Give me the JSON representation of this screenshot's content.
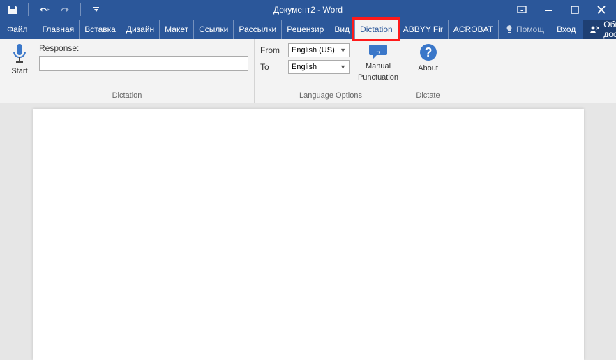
{
  "title": "Документ2 - Word",
  "tabs": {
    "file": "Файл",
    "list": [
      "Главная",
      "Вставка",
      "Дизайн",
      "Макет",
      "Ссылки",
      "Рассылки",
      "Рецензир",
      "Вид",
      "Dictation",
      "ABBYY Fir",
      "ACROBAT"
    ],
    "active_index": 8,
    "help": "Помощ",
    "login": "Вход",
    "share": "Общий доступ"
  },
  "ribbon": {
    "group_dictation": {
      "label": "Dictation",
      "start": "Start",
      "response": "Response:",
      "response_value": ""
    },
    "group_lang": {
      "label": "Language Options",
      "from_label": "From",
      "to_label": "To",
      "from_value": "English (US)",
      "to_value": "English",
      "manual_line1": "Manual",
      "manual_line2": "Punctuation"
    },
    "group_dictate": {
      "label": "Dictate",
      "about": "About"
    }
  }
}
